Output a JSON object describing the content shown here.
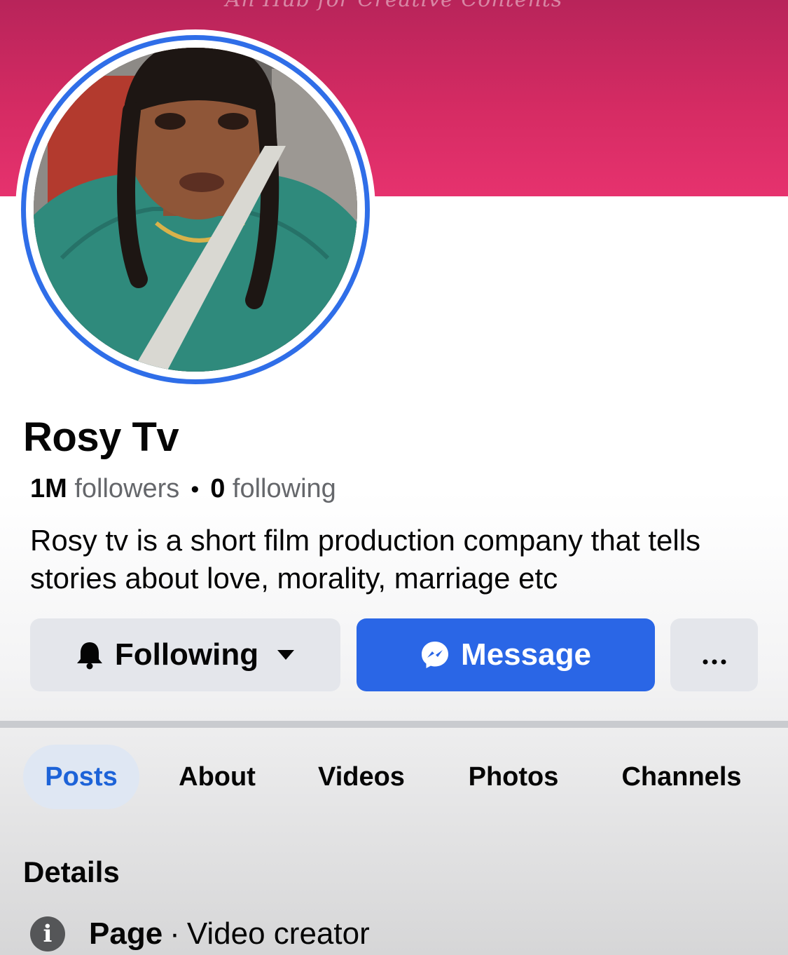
{
  "cover": {
    "tagline": "An Hub for Creative Contents",
    "gradient_top": "#b8245a",
    "gradient_bottom": "#e6326e"
  },
  "profile": {
    "name": "Rosy Tv",
    "followers_count": "1M",
    "followers_label": "followers",
    "following_count": "0",
    "following_label": "following",
    "bio": "Rosy tv is a short film production company that tells stories about love, morality, marriage etc"
  },
  "actions": {
    "following_label": "Following",
    "following_icon": "bell-icon",
    "message_label": "Message",
    "message_icon": "messenger-icon",
    "more_icon": "ellipsis-icon",
    "accent_color": "#2a66e6"
  },
  "tabs": [
    {
      "label": "Posts",
      "active": true
    },
    {
      "label": "About",
      "active": false
    },
    {
      "label": "Videos",
      "active": false
    },
    {
      "label": "Photos",
      "active": false
    },
    {
      "label": "Channels",
      "active": false
    }
  ],
  "details": {
    "title": "Details",
    "row": {
      "icon": "info-icon",
      "category": "Page",
      "separator": "·",
      "value": "Video creator"
    }
  }
}
